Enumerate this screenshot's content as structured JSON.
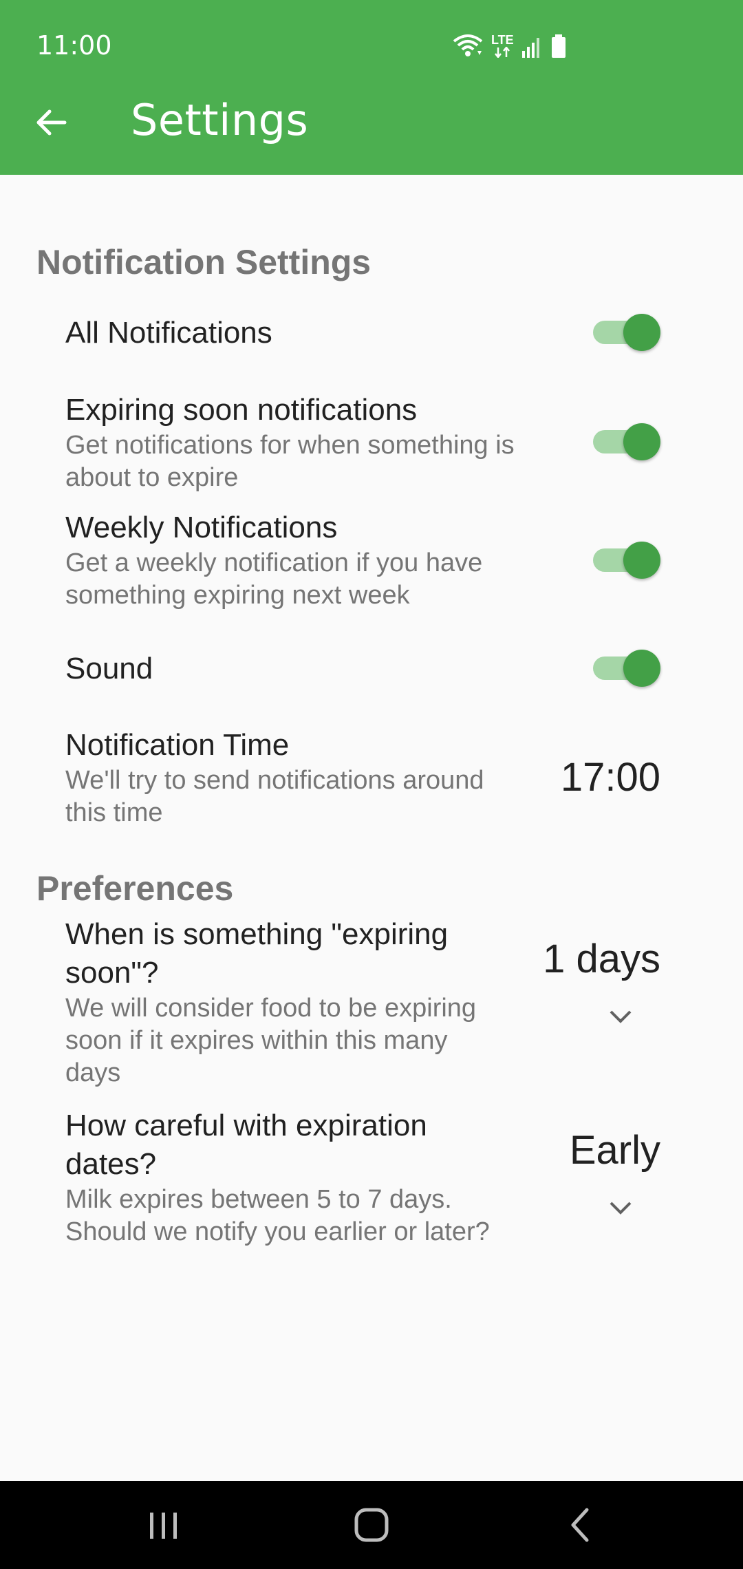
{
  "status_bar": {
    "time": "11:00",
    "network_label": "LTE"
  },
  "app_bar": {
    "title": "Settings",
    "back_icon": "arrow-left-icon"
  },
  "colors": {
    "primary": "#4caf50",
    "switch_on": "#43a047",
    "switch_track": "#a5d6a7"
  },
  "notification_section": {
    "header": "Notification Settings",
    "all": {
      "title": "All Notifications",
      "enabled": true
    },
    "expiring": {
      "title": "Expiring soon notifications",
      "sub1": "Get notifications for when something is",
      "sub2": "about to expire",
      "enabled": true
    },
    "weekly": {
      "title": "Weekly Notifications",
      "sub1": "Get a weekly notification if you have",
      "sub2": "something expiring next week",
      "enabled": true
    },
    "sound": {
      "title": "Sound",
      "enabled": true
    },
    "time": {
      "title": "Notification Time",
      "sub1": "We'll try to send notifications around",
      "sub2": "this time",
      "value": "17:00"
    }
  },
  "preferences_section": {
    "header": "Preferences",
    "expiring_soon": {
      "title1": "When is something \"expiring",
      "title2": "soon\"?",
      "sub1": "We will consider food to be expiring",
      "sub2": "soon if it expires within this many",
      "sub3": "days",
      "value": "1 days"
    },
    "careful": {
      "title1": "How careful with expiration",
      "title2": "dates?",
      "sub1": "Milk expires between 5 to 7 days.",
      "sub2": "Should we notify you earlier or later?",
      "value": "Early"
    }
  },
  "nav_bar": {
    "recents_icon": "recents-icon",
    "home_icon": "home-icon",
    "back_icon": "back-chevron-icon"
  }
}
